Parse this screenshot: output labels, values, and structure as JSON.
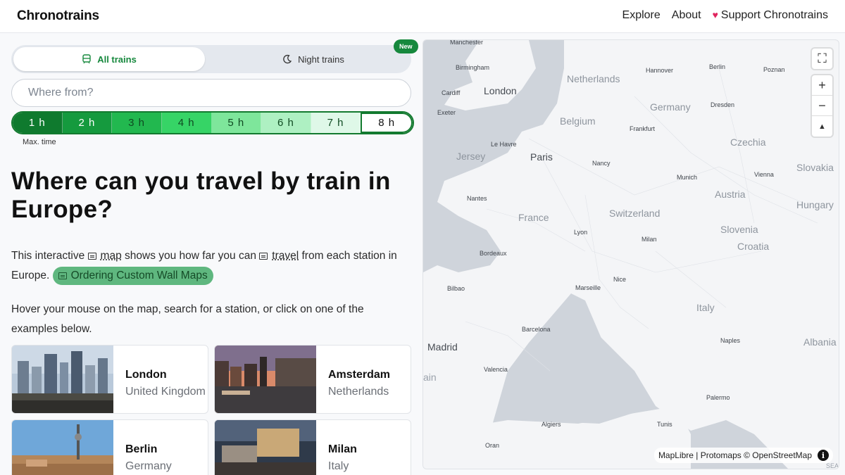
{
  "app": {
    "brand": "Chronotrains"
  },
  "nav": {
    "explore": "Explore",
    "about": "About",
    "support": "Support Chronotrains"
  },
  "modes": {
    "all_trains": "All trains",
    "night_trains": "Night trains",
    "new_badge": "New"
  },
  "search": {
    "placeholder": "Where from?"
  },
  "hours": {
    "items": [
      "1 h",
      "2 h",
      "3 h",
      "4 h",
      "5 h",
      "6 h",
      "7 h",
      "8 h"
    ],
    "selected": "8 h",
    "label": "Max. time"
  },
  "main": {
    "title": "Where can you travel by train in Europe?",
    "intro_a": "This interactive ",
    "intro_map": "map",
    "intro_b": " shows you how far you can ",
    "intro_travel": "travel",
    "intro_c": " from each station in Europe. ",
    "custom_maps": "Ordering Custom Wall Maps",
    "hover_text": "Hover your mouse on the map, search for a station, or click on one of the examples below."
  },
  "examples": [
    {
      "city": "London",
      "country": "United Kingdom"
    },
    {
      "city": "Amsterdam",
      "country": "Netherlands"
    },
    {
      "city": "Berlin",
      "country": "Germany"
    },
    {
      "city": "Milan",
      "country": "Italy"
    }
  ],
  "map": {
    "countries": [
      "Netherlands",
      "Belgium",
      "Germany",
      "Czechia",
      "Slovakia",
      "Austria",
      "Hungary",
      "France",
      "Switzerland",
      "Slovenia",
      "Croatia",
      "Italy",
      "Albania",
      "Jersey"
    ],
    "cities": [
      "Manchester",
      "Birmingham",
      "Cardiff",
      "Exeter",
      "Hannover",
      "Berlin",
      "Poznan",
      "Dresden",
      "Frankfurt",
      "Le Havre",
      "Nancy",
      "Munich",
      "Vienna",
      "Nantes",
      "Lyon",
      "Milan",
      "Bordeaux",
      "Marseille",
      "Nice",
      "Bilbao",
      "Barcelona",
      "Naples",
      "Valencia",
      "Palermo",
      "Algiers",
      "Tunis",
      "Oran"
    ],
    "big_cities": [
      "London",
      "Paris",
      "Madrid"
    ],
    "seas": [
      "ain",
      "SEA"
    ],
    "attribution": "MapLibre | Protomaps © OpenStreetMap",
    "controls": {
      "fullscreen": "⛶",
      "zoom_in": "+",
      "zoom_out": "−",
      "compass": "▲"
    }
  },
  "colors": {
    "accent": "#16883d",
    "hour_fills": [
      "#0f7a2e",
      "#159a3e",
      "#22b84f",
      "#36d466",
      "#7ee69b",
      "#aef0c2",
      "#dff8e8",
      "#ffffff"
    ],
    "hour_text": [
      "#ffffff",
      "#ffffff",
      "#0f4a21",
      "#0f4a21",
      "#0f4a21",
      "#0f4a21",
      "#0f4a21",
      "#111111"
    ]
  },
  "icons": {
    "all_trains": "train-icon",
    "night_trains": "moon-icon",
    "support": "heart-icon",
    "wiki": "wiki-icon",
    "info": "info-icon"
  }
}
